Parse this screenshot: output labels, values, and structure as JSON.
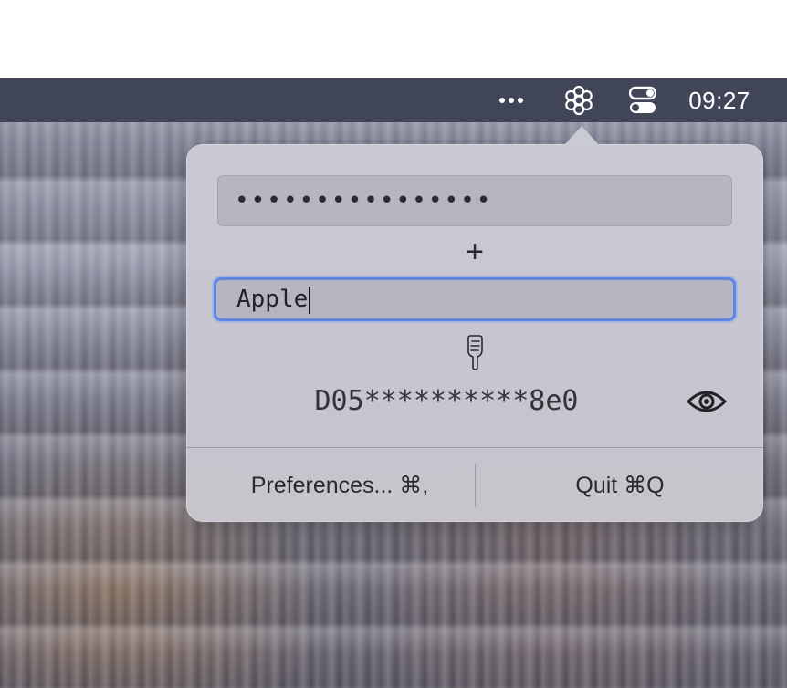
{
  "menubar": {
    "more_icon": "ellipsis-icon",
    "app_icon": "flower-icon",
    "control_center_icon": "toggle-icon",
    "clock": "09:27"
  },
  "popover": {
    "secret_field_value": "••••••••••••••••",
    "plus_label": "+",
    "site_field_value": "Apple",
    "pointer_icon": "pointing-down-hand-icon",
    "generated_password": "D05**********8e0",
    "reveal_icon": "eye-icon",
    "preferences_label": "Preferences... ⌘,",
    "quit_label": "Quit ⌘Q"
  }
}
